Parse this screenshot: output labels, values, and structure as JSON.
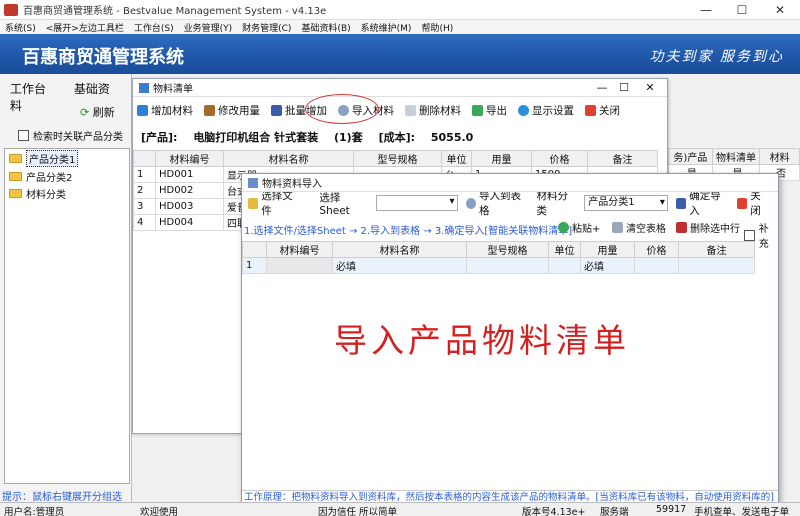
{
  "window": {
    "title": "百惠商贸通管理系统 - Bestvalue Management System  - v4.13e",
    "controls": [
      "—",
      "☐",
      "✕"
    ]
  },
  "menu": [
    "系统(S)",
    "<展开>左边工具栏",
    "工作台(S)",
    "业务管理(Y)",
    "财务管理(C)",
    "基础资料(B)",
    "系统维护(M)",
    "帮助(H)"
  ],
  "banner": {
    "brand": "百惠商贸通管理系统",
    "slogan": "功夫到家 服务到心"
  },
  "left": {
    "tabs": [
      "工作台",
      "基础资料"
    ],
    "refresh_label": "刷新",
    "assoc_label": "检索时关联产品分类",
    "tree": [
      "产品分类1",
      "产品分类2",
      "材料分类"
    ],
    "hint": "提示：鼠标右键展开分组选项"
  },
  "main": {
    "title": "物料清单",
    "toolbar": [
      "增加材料",
      "修改用量",
      "批量增加",
      "导入材料",
      "删除材料",
      "导出",
      "显示设置",
      "关闭"
    ],
    "product_label": "[产品]:",
    "product_name": "电脑打印机组合 针式套装",
    "product_qty": "(1)套",
    "cost_label": "[成本]:",
    "cost_value": "5055.0",
    "columns": [
      "",
      "材料编号",
      "材料名称",
      "型号规格",
      "单位",
      "用量",
      "价格",
      "备注"
    ],
    "rows": [
      [
        "1",
        "HD001",
        "显示器",
        "",
        "台",
        "1",
        "1500",
        ""
      ],
      [
        "2",
        "HD002",
        "台式",
        "",
        "",
        "",
        "",
        ""
      ],
      [
        "3",
        "HD003",
        "爱普",
        "",
        "",
        "",
        "",
        ""
      ],
      [
        "4",
        "HD004",
        "四联",
        "",
        "",
        "",
        "",
        ""
      ]
    ]
  },
  "bg_table": {
    "columns": [
      "务)产品",
      "物料清单",
      "材料"
    ],
    "rows": [
      [
        "是",
        "是",
        "否"
      ]
    ]
  },
  "import": {
    "title": "物料资料导入",
    "select_file": "选择文件",
    "select_sheet": "选择Sheet",
    "import_to_table": "导入到表格",
    "category_label": "材料分类",
    "category_value": "产品分类1",
    "confirm": "确定导入",
    "close": "关闭",
    "steps": "1.选择文件/选择Sheet → 2.导入到表格 → 3.确定导入[智能关联物料清单]",
    "paste": "粘贴+",
    "clear": "清空表格",
    "delete_row": "删除选中行",
    "supplement": "补充",
    "columns": [
      "",
      "材料编号",
      "材料名称",
      "型号规格",
      "单位",
      "用量",
      "价格",
      "备注"
    ],
    "row": [
      "1",
      "",
      "必填",
      "",
      "",
      "必填",
      "",
      ""
    ],
    "big_title": "导入产品物料清单",
    "principle": "工作原理：把物料资料导入到资料库，然后按本表格的内容生成该产品的物料清单。[当资料库已有该物料，自动使用资料库的]"
  },
  "status": {
    "user": "用户名:管理员",
    "welcome": "欢迎使用",
    "motto": "因为信任 所以简单",
    "version": "版本号4.13e+",
    "server": "服务端",
    "number": "59917",
    "tail": "手机查单、发送电子单"
  }
}
